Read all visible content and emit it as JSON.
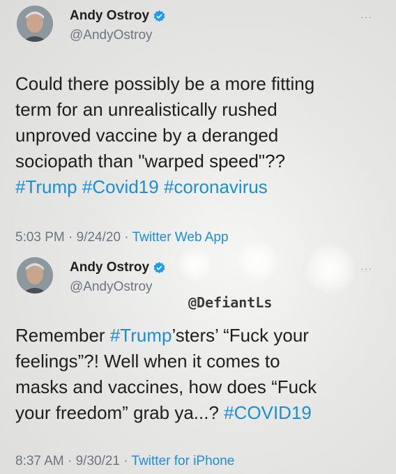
{
  "tweets": [
    {
      "display_name": "Andy Ostroy",
      "handle": "@AndyOstroy",
      "more_label": "···",
      "text_line1": "Could there possibly be a more fitting",
      "text_line2": "term for an unrealistically rushed",
      "text_line3": "unproved vaccine by a deranged",
      "text_line4": "sociopath than \"warped speed\"??",
      "hashtag1": "#Trump",
      "hashtag2": "#Covid19",
      "hashtag3": "#coronavirus",
      "time": "5:03 PM · 9/24/20 · ",
      "source": "Twitter Web App"
    },
    {
      "display_name": "Andy Ostroy",
      "handle": "@AndyOstroy",
      "more_label": "···",
      "text_pre": "Remember ",
      "hashtag_trump": "#Trump",
      "text_mid": "’sters’ “Fuck your",
      "text_line2": "feelings”?! Well when it comes to",
      "text_line3": "masks and vaccines, how does “Fuck",
      "text_line4": "your freedom” grab ya...? ",
      "hashtag_covid": "#COVID19",
      "time": "8:37 AM · 9/30/21 · ",
      "source": "Twitter for iPhone"
    }
  ],
  "watermark": "@DefiantLs",
  "colors": {
    "link": "#1d8ed6",
    "verified": "#1d9bf0",
    "secondary": "#6b7680"
  },
  "icons": {
    "verified": "verified-badge-icon",
    "more": "more-options-icon"
  }
}
